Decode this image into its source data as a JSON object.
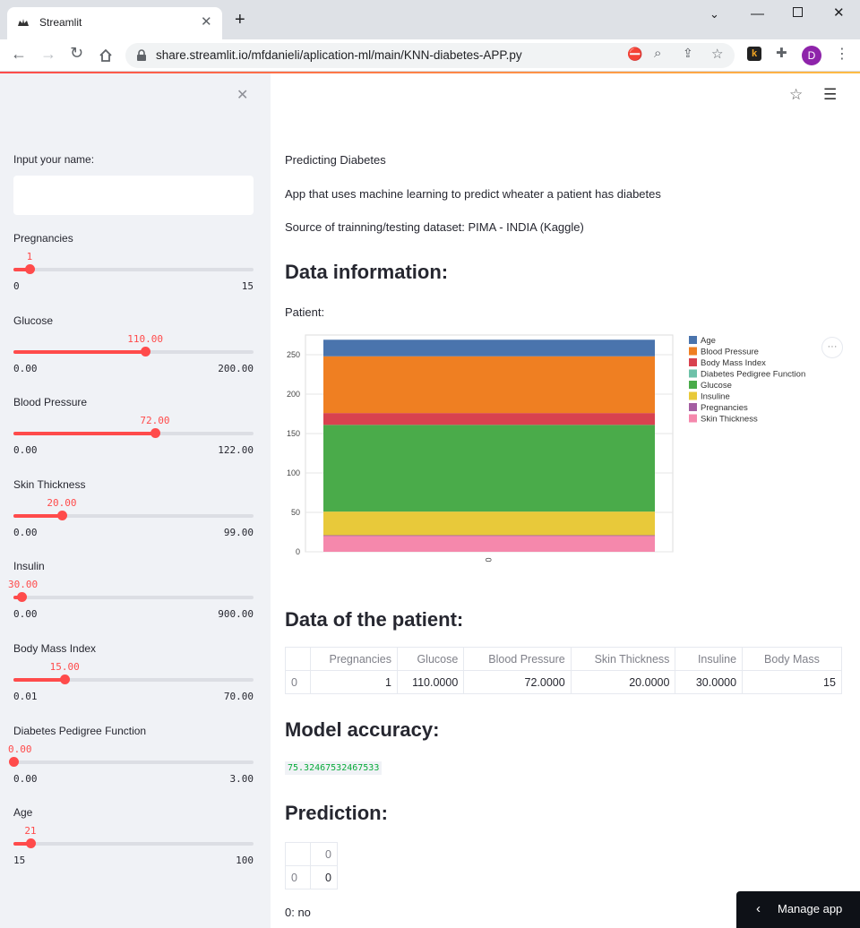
{
  "browser": {
    "tab_title": "Streamlit",
    "url": "share.streamlit.io/mfdanieli/aplication-ml/main/KNN-diabetes-APP.py",
    "profile_initial": "D"
  },
  "sidebar": {
    "name_label": "Input your name:",
    "name_value": "",
    "sliders": [
      {
        "label": "Pregnancies",
        "value": "1",
        "min": "0",
        "max": "15",
        "fraction": 0.067
      },
      {
        "label": "Glucose",
        "value": "110.00",
        "min": "0.00",
        "max": "200.00",
        "fraction": 0.55
      },
      {
        "label": "Blood Pressure",
        "value": "72.00",
        "min": "0.00",
        "max": "122.00",
        "fraction": 0.59
      },
      {
        "label": "Skin Thickness",
        "value": "20.00",
        "min": "0.00",
        "max": "99.00",
        "fraction": 0.202
      },
      {
        "label": "Insulin",
        "value": "30.00",
        "min": "0.00",
        "max": "900.00",
        "fraction": 0.033
      },
      {
        "label": "Body Mass Index",
        "value": "15.00",
        "min": "0.01",
        "max": "70.00",
        "fraction": 0.214
      },
      {
        "label": "Diabetes Pedigree Function",
        "value": "0.00",
        "min": "0.00",
        "max": "3.00",
        "fraction": 0.0
      },
      {
        "label": "Age",
        "value": "21",
        "min": "15",
        "max": "100",
        "fraction": 0.071
      }
    ]
  },
  "main": {
    "title": "Predicting Diabetes",
    "description": "App that uses machine learning to predict wheater a patient has diabetes",
    "source": "Source of trainning/testing dataset: PIMA - INDIA (Kaggle)",
    "data_info_heading": "Data information:",
    "patient_label": "Patient:",
    "data_patient_heading": "Data of the patient:",
    "table": {
      "columns": [
        "",
        "Pregnancies",
        "Glucose",
        "Blood Pressure",
        "Skin Thickness",
        "Insuline",
        "Body Mass"
      ],
      "rows": [
        [
          "0",
          "1",
          "110.0000",
          "72.0000",
          "20.0000",
          "30.0000",
          "15"
        ]
      ]
    },
    "accuracy_heading": "Model accuracy:",
    "accuracy_value": "75.32467532467533",
    "prediction_heading": "Prediction:",
    "prediction_table": {
      "columns": [
        "",
        "0"
      ],
      "rows": [
        [
          "0",
          "0"
        ]
      ]
    },
    "prediction_note": "0: no",
    "manage_app": "Manage app"
  },
  "chart_data": {
    "type": "bar",
    "stacked": true,
    "categories": [
      "0"
    ],
    "series": [
      {
        "name": "Skin Thickness",
        "values": [
          20
        ],
        "color": "#f588ac"
      },
      {
        "name": "Pregnancies",
        "values": [
          1
        ],
        "color": "#a45ea1"
      },
      {
        "name": "Insuline",
        "values": [
          30
        ],
        "color": "#e8c93a"
      },
      {
        "name": "Glucose",
        "values": [
          110
        ],
        "color": "#4aab4a"
      },
      {
        "name": "Diabetes Pedigree Function",
        "values": [
          0
        ],
        "color": "#6dc1a8"
      },
      {
        "name": "Body Mass Index",
        "values": [
          15
        ],
        "color": "#d8424f"
      },
      {
        "name": "Blood Pressure",
        "values": [
          72
        ],
        "color": "#ef7f22"
      },
      {
        "name": "Age",
        "values": [
          21
        ],
        "color": "#4a74ad"
      }
    ],
    "legend_order": [
      "Age",
      "Blood Pressure",
      "Body Mass Index",
      "Diabetes Pedigree Function",
      "Glucose",
      "Insuline",
      "Pregnancies",
      "Skin Thickness"
    ],
    "yticks": [
      0,
      50,
      100,
      150,
      200,
      250
    ],
    "ylim": [
      0,
      275
    ],
    "legend_position": "right",
    "grid": true
  }
}
